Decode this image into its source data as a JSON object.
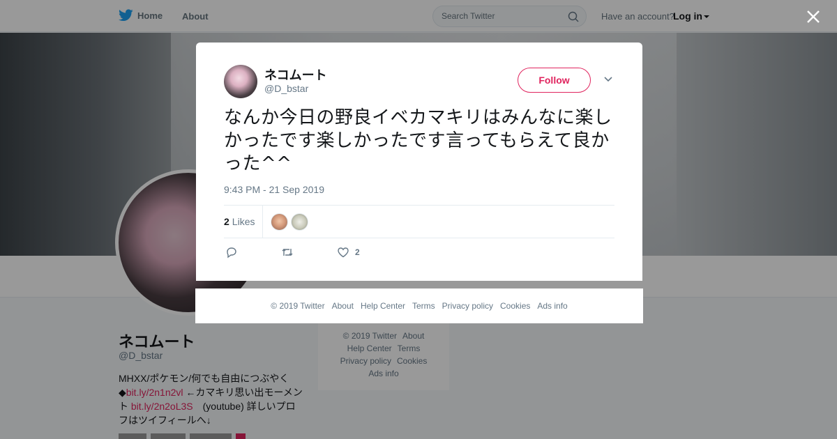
{
  "nav": {
    "home_label": "Home",
    "about_label": "About",
    "search_placeholder": "Search Twitter",
    "have_account": "Have an account?",
    "login_label": "Log in"
  },
  "profile": {
    "name": "ネコムート",
    "handle": "@D_bstar",
    "bio_text_1": "MHXX/ポケモン/何でも自由につぶやく◆",
    "bio_link_1": "bit.ly/2n1n2vl",
    "bio_text_2": " ←カマキリ思い出モーメント ",
    "bio_link_2": "bit.ly/2n2oL3S",
    "bio_text_3": "　(youtube) 詳しいプロフはツイフィールへ↓"
  },
  "side_footer": {
    "items": [
      "© 2019 Twitter",
      "About",
      "Help Center",
      "Terms",
      "Privacy policy",
      "Cookies",
      "Ads info"
    ]
  },
  "tweet": {
    "author_name": "ネコムート",
    "author_handle": "@D_bstar",
    "follow_label": "Follow",
    "text": "なんか今日の野良イベカマキリはみんなに楽しかったです楽しかったです言ってもらえて良かった^^",
    "timestamp": "9:43 PM - 21 Sep 2019",
    "likes_count": "2",
    "likes_label": "Likes",
    "like_action_count": "2"
  },
  "modal_footer": {
    "items": [
      "© 2019 Twitter",
      "About",
      "Help Center",
      "Terms",
      "Privacy policy",
      "Cookies",
      "Ads info"
    ]
  },
  "colors": {
    "accent": "#e0245e",
    "twitter_blue": "#1da1f2",
    "muted": "#657786"
  },
  "icons": [
    "twitter-bird-icon",
    "search-icon",
    "caret-down-icon",
    "close-icon",
    "chevron-down-icon",
    "reply-icon",
    "retweet-icon",
    "heart-icon"
  ]
}
